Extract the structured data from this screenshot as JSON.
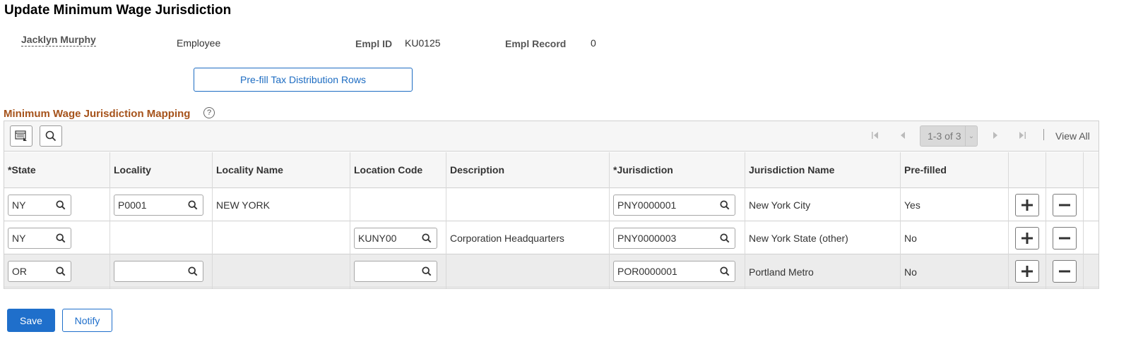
{
  "page": {
    "title": "Update Minimum Wage Jurisdiction"
  },
  "employee": {
    "name": "Jacklyn Murphy",
    "type": "Employee",
    "empl_id_label": "Empl ID",
    "empl_id": "KU0125",
    "empl_record_label": "Empl Record",
    "empl_record": "0"
  },
  "actions": {
    "prefill_label": "Pre-fill Tax Distribution Rows",
    "save_label": "Save",
    "notify_label": "Notify"
  },
  "grid": {
    "title": "Minimum Wage Jurisdiction Mapping",
    "help_icon": "?",
    "pager_text": "1-3 of 3",
    "view_all": "View All",
    "columns": [
      "*State",
      "Locality",
      "Locality Name",
      "Location Code",
      "Description",
      "*Jurisdiction",
      "Jurisdiction Name",
      "Pre-filled"
    ],
    "rows": [
      {
        "state": "NY",
        "locality": "P0001",
        "locality_name": "NEW YORK",
        "location_code": "",
        "description": "",
        "jurisdiction": "PNY0000001",
        "jurisdiction_name": "New York City",
        "prefilled": "Yes"
      },
      {
        "state": "NY",
        "locality": "",
        "locality_name": "",
        "location_code": "KUNY00",
        "description": "Corporation Headquarters",
        "jurisdiction": "PNY0000003",
        "jurisdiction_name": "New York State (other)",
        "prefilled": "No"
      },
      {
        "state": "OR",
        "locality": "",
        "locality_name": "",
        "location_code": "",
        "description": "",
        "jurisdiction": "POR0000001",
        "jurisdiction_name": "Portland Metro",
        "prefilled": "No"
      }
    ]
  },
  "icons": {
    "search": "search-icon",
    "grid_personalize": "grid-personalize-icon",
    "first": "first-page-icon",
    "prev": "previous-page-icon",
    "next": "next-page-icon",
    "last": "last-page-icon",
    "add": "add-row-icon",
    "delete": "delete-row-icon"
  },
  "colors": {
    "accent": "#1f6fcb",
    "section_title": "#a6531b",
    "header_bg": "#f6f6f6",
    "alt_row_bg": "#ececec"
  }
}
